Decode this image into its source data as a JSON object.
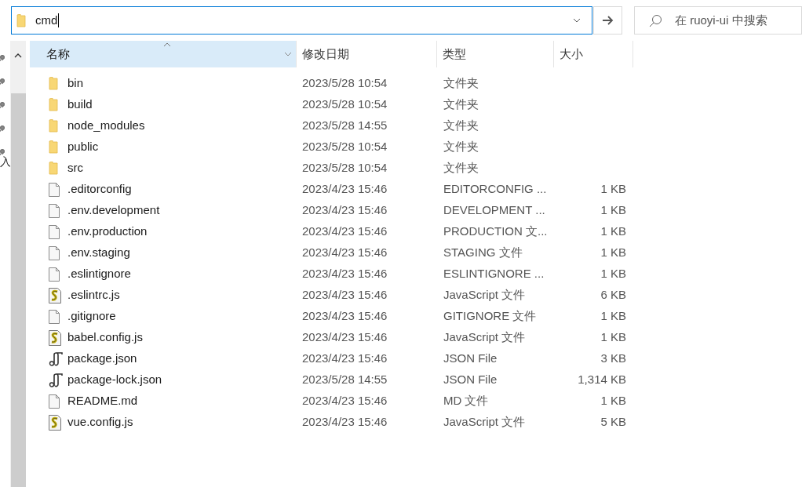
{
  "address_bar": {
    "value": "cmd"
  },
  "search": {
    "placeholder": "在 ruoyi-ui 中搜索"
  },
  "nav_pane": {
    "texts": [
      "入"
    ]
  },
  "table": {
    "columns": [
      {
        "label": "名称",
        "sorted": true
      },
      {
        "label": "修改日期",
        "sorted": false
      },
      {
        "label": "类型",
        "sorted": false
      },
      {
        "label": "大小",
        "sorted": false
      }
    ],
    "rows": [
      {
        "kind": "folder",
        "name": "bin",
        "date": "2023/5/28 10:54",
        "type": "文件夹",
        "size": ""
      },
      {
        "kind": "folder",
        "name": "build",
        "date": "2023/5/28 10:54",
        "type": "文件夹",
        "size": ""
      },
      {
        "kind": "folder",
        "name": "node_modules",
        "date": "2023/5/28 14:55",
        "type": "文件夹",
        "size": ""
      },
      {
        "kind": "folder",
        "name": "public",
        "date": "2023/5/28 10:54",
        "type": "文件夹",
        "size": ""
      },
      {
        "kind": "folder",
        "name": "src",
        "date": "2023/5/28 10:54",
        "type": "文件夹",
        "size": ""
      },
      {
        "kind": "file",
        "name": ".editorconfig",
        "date": "2023/4/23 15:46",
        "type": "EDITORCONFIG ...",
        "size": "1 KB"
      },
      {
        "kind": "file",
        "name": ".env.development",
        "date": "2023/4/23 15:46",
        "type": "DEVELOPMENT ...",
        "size": "1 KB"
      },
      {
        "kind": "file",
        "name": ".env.production",
        "date": "2023/4/23 15:46",
        "type": "PRODUCTION 文...",
        "size": "1 KB"
      },
      {
        "kind": "file",
        "name": ".env.staging",
        "date": "2023/4/23 15:46",
        "type": "STAGING 文件",
        "size": "1 KB"
      },
      {
        "kind": "file",
        "name": ".eslintignore",
        "date": "2023/4/23 15:46",
        "type": "ESLINTIGNORE ...",
        "size": "1 KB"
      },
      {
        "kind": "script",
        "name": ".eslintrc.js",
        "date": "2023/4/23 15:46",
        "type": "JavaScript 文件",
        "size": "6 KB"
      },
      {
        "kind": "file",
        "name": ".gitignore",
        "date": "2023/4/23 15:46",
        "type": "GITIGNORE 文件",
        "size": "1 KB"
      },
      {
        "kind": "script",
        "name": "babel.config.js",
        "date": "2023/4/23 15:46",
        "type": "JavaScript 文件",
        "size": "1 KB"
      },
      {
        "kind": "json",
        "name": "package.json",
        "date": "2023/4/23 15:46",
        "type": "JSON File",
        "size": "3 KB"
      },
      {
        "kind": "json",
        "name": "package-lock.json",
        "date": "2023/5/28 14:55",
        "type": "JSON File",
        "size": "1,314 KB"
      },
      {
        "kind": "file",
        "name": "README.md",
        "date": "2023/4/23 15:46",
        "type": "MD 文件",
        "size": "1 KB"
      },
      {
        "kind": "script",
        "name": "vue.config.js",
        "date": "2023/4/23 15:46",
        "type": "JavaScript 文件",
        "size": "5 KB"
      }
    ]
  }
}
